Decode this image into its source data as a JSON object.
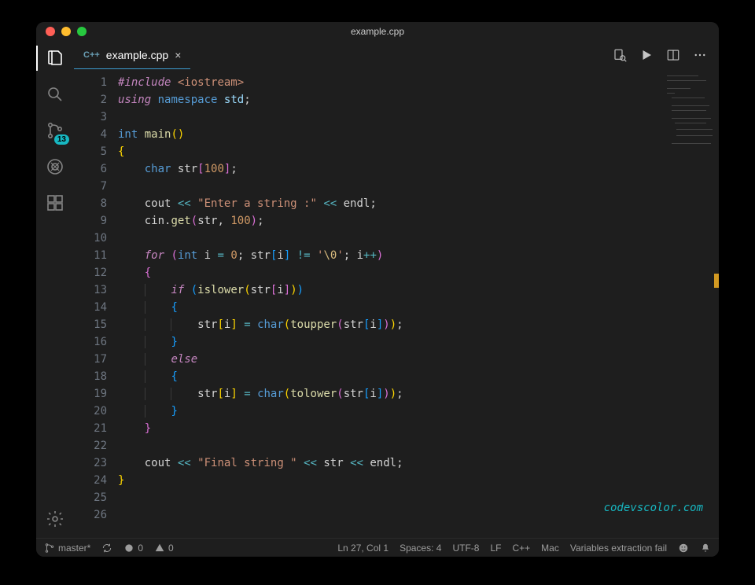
{
  "titlebar": {
    "title": "example.cpp"
  },
  "tab": {
    "lang": "C++",
    "label": "example.cpp",
    "close": "×"
  },
  "activity": {
    "scm_badge": "13"
  },
  "code": {
    "lines": [
      [
        [
          "kw",
          "#include"
        ],
        [
          "punct",
          " "
        ],
        [
          "str",
          "<iostream>"
        ]
      ],
      [
        [
          "kw",
          "using"
        ],
        [
          "punct",
          " "
        ],
        [
          "type",
          "namespace"
        ],
        [
          "punct",
          " "
        ],
        [
          "var",
          "std"
        ],
        [
          "punct",
          ";"
        ]
      ],
      [],
      [
        [
          "type",
          "int"
        ],
        [
          "punct",
          " "
        ],
        [
          "fn",
          "main"
        ],
        [
          "brace",
          "()"
        ]
      ],
      [
        [
          "brace",
          "{"
        ]
      ],
      [
        [
          "punct",
          "    "
        ],
        [
          "type",
          "char"
        ],
        [
          "punct",
          " "
        ],
        [
          "id",
          "str"
        ],
        [
          "brace2",
          "["
        ],
        [
          "num",
          "100"
        ],
        [
          "brace2",
          "]"
        ],
        [
          "punct",
          ";"
        ]
      ],
      [],
      [
        [
          "punct",
          "    "
        ],
        [
          "id",
          "cout"
        ],
        [
          "punct",
          " "
        ],
        [
          "op",
          "<<"
        ],
        [
          "punct",
          " "
        ],
        [
          "str",
          "\"Enter a string :\""
        ],
        [
          "punct",
          " "
        ],
        [
          "op",
          "<<"
        ],
        [
          "punct",
          " "
        ],
        [
          "id",
          "endl"
        ],
        [
          "punct",
          ";"
        ]
      ],
      [
        [
          "punct",
          "    "
        ],
        [
          "id",
          "cin"
        ],
        [
          "punct",
          "."
        ],
        [
          "fn",
          "get"
        ],
        [
          "brace2",
          "("
        ],
        [
          "id",
          "str"
        ],
        [
          "punct",
          ", "
        ],
        [
          "num",
          "100"
        ],
        [
          "brace2",
          ")"
        ],
        [
          "punct",
          ";"
        ]
      ],
      [],
      [
        [
          "punct",
          "    "
        ],
        [
          "kw",
          "for"
        ],
        [
          "punct",
          " "
        ],
        [
          "brace2",
          "("
        ],
        [
          "type",
          "int"
        ],
        [
          "punct",
          " "
        ],
        [
          "id",
          "i"
        ],
        [
          "punct",
          " "
        ],
        [
          "op",
          "="
        ],
        [
          "punct",
          " "
        ],
        [
          "num",
          "0"
        ],
        [
          "punct",
          "; "
        ],
        [
          "id",
          "str"
        ],
        [
          "brace3",
          "["
        ],
        [
          "id",
          "i"
        ],
        [
          "brace3",
          "]"
        ],
        [
          "punct",
          " "
        ],
        [
          "op",
          "!="
        ],
        [
          "punct",
          " "
        ],
        [
          "str",
          "'"
        ],
        [
          "esc",
          "\\0"
        ],
        [
          "str",
          "'"
        ],
        [
          "punct",
          "; "
        ],
        [
          "id",
          "i"
        ],
        [
          "op",
          "++"
        ],
        [
          "brace2",
          ")"
        ]
      ],
      [
        [
          "punct",
          "    "
        ],
        [
          "brace2",
          "{"
        ]
      ],
      [
        [
          "punct",
          "        "
        ],
        [
          "kw",
          "if"
        ],
        [
          "punct",
          " "
        ],
        [
          "brace3",
          "("
        ],
        [
          "fn",
          "islower"
        ],
        [
          "brace",
          "("
        ],
        [
          "id",
          "str"
        ],
        [
          "brace2",
          "["
        ],
        [
          "id",
          "i"
        ],
        [
          "brace2",
          "]"
        ],
        [
          "brace",
          ")"
        ],
        [
          "brace3",
          ")"
        ]
      ],
      [
        [
          "punct",
          "        "
        ],
        [
          "brace3",
          "{"
        ]
      ],
      [
        [
          "punct",
          "            "
        ],
        [
          "id",
          "str"
        ],
        [
          "brace",
          "["
        ],
        [
          "id",
          "i"
        ],
        [
          "brace",
          "]"
        ],
        [
          "punct",
          " "
        ],
        [
          "op",
          "="
        ],
        [
          "punct",
          " "
        ],
        [
          "type",
          "char"
        ],
        [
          "brace",
          "("
        ],
        [
          "fn",
          "toupper"
        ],
        [
          "brace2",
          "("
        ],
        [
          "id",
          "str"
        ],
        [
          "brace3",
          "["
        ],
        [
          "id",
          "i"
        ],
        [
          "brace3",
          "]"
        ],
        [
          "brace2",
          ")"
        ],
        [
          "brace",
          ")"
        ],
        [
          "punct",
          ";"
        ]
      ],
      [
        [
          "punct",
          "        "
        ],
        [
          "brace3",
          "}"
        ]
      ],
      [
        [
          "punct",
          "        "
        ],
        [
          "kw",
          "else"
        ]
      ],
      [
        [
          "punct",
          "        "
        ],
        [
          "brace3",
          "{"
        ]
      ],
      [
        [
          "punct",
          "            "
        ],
        [
          "id",
          "str"
        ],
        [
          "brace",
          "["
        ],
        [
          "id",
          "i"
        ],
        [
          "brace",
          "]"
        ],
        [
          "punct",
          " "
        ],
        [
          "op",
          "="
        ],
        [
          "punct",
          " "
        ],
        [
          "type",
          "char"
        ],
        [
          "brace",
          "("
        ],
        [
          "fn",
          "tolower"
        ],
        [
          "brace2",
          "("
        ],
        [
          "id",
          "str"
        ],
        [
          "brace3",
          "["
        ],
        [
          "id",
          "i"
        ],
        [
          "brace3",
          "]"
        ],
        [
          "brace2",
          ")"
        ],
        [
          "brace",
          ")"
        ],
        [
          "punct",
          ";"
        ]
      ],
      [
        [
          "punct",
          "        "
        ],
        [
          "brace3",
          "}"
        ]
      ],
      [
        [
          "punct",
          "    "
        ],
        [
          "brace2",
          "}"
        ]
      ],
      [],
      [
        [
          "punct",
          "    "
        ],
        [
          "id",
          "cout"
        ],
        [
          "punct",
          " "
        ],
        [
          "op",
          "<<"
        ],
        [
          "punct",
          " "
        ],
        [
          "str",
          "\"Final string \""
        ],
        [
          "punct",
          " "
        ],
        [
          "op",
          "<<"
        ],
        [
          "punct",
          " "
        ],
        [
          "id",
          "str"
        ],
        [
          "punct",
          " "
        ],
        [
          "op",
          "<<"
        ],
        [
          "punct",
          " "
        ],
        [
          "id",
          "endl"
        ],
        [
          "punct",
          ";"
        ]
      ],
      [
        [
          "brace",
          "}"
        ]
      ],
      [],
      []
    ]
  },
  "watermark": "codevscolor.com",
  "status": {
    "branch": "master*",
    "errors": "0",
    "warnings": "0",
    "cursor": "Ln 27, Col 1",
    "spaces": "Spaces: 4",
    "encoding": "UTF-8",
    "eol": "LF",
    "language": "C++",
    "os": "Mac",
    "message": "Variables extraction fail"
  }
}
